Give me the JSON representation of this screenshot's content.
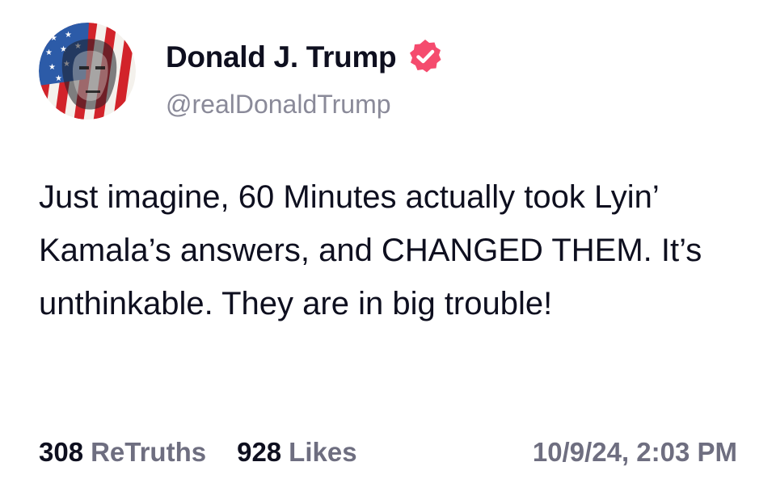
{
  "author": {
    "display_name": "Donald J. Trump",
    "handle": "@realDonaldTrump",
    "avatar_icon": "flag-portrait-avatar",
    "verified_icon": "verified-badge-icon",
    "verified_color": "#f54b6e"
  },
  "post": {
    "text": "Just imagine, 60 Minutes actually took Lyin’ Kamala’s answers, and CHANGED THEM. It’s unthinkable. They are in big trouble!"
  },
  "stats": {
    "retruths_count": "308",
    "retruths_label": "ReTruths",
    "likes_count": "928",
    "likes_label": "Likes"
  },
  "timestamp": "10/9/24, 2:03 PM",
  "colors": {
    "text_primary": "#0e0f1f",
    "text_secondary": "#6e6e80",
    "handle": "#8a8a99",
    "flag_red": "#d2232a",
    "flag_blue": "#2c5ba8"
  }
}
